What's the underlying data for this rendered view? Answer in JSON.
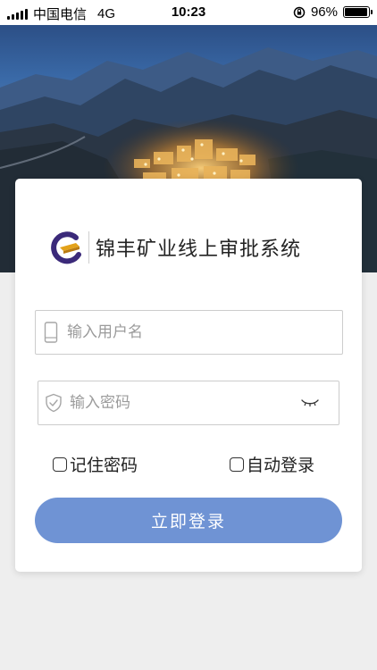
{
  "status_bar": {
    "carrier": "中国电信",
    "network": "4G",
    "time": "10:23",
    "battery": "96%",
    "battery_level": 0.96
  },
  "brand": {
    "title": "锦丰矿业线上审批系统",
    "logo_colors": {
      "ring": "#3b2a7a",
      "bar": "#e3a21a"
    }
  },
  "form": {
    "username_placeholder": "输入用户名",
    "password_placeholder": "输入密码",
    "remember_password_label": "记住密码",
    "auto_login_label": "自动登录",
    "login_button_label": "立即登录"
  },
  "icons": {
    "username": "phone-icon",
    "password": "shield-check-icon",
    "password_toggle": "eye-closed-icon"
  },
  "colors": {
    "button": "#6f93d4",
    "page_background": "#eeeeee"
  }
}
